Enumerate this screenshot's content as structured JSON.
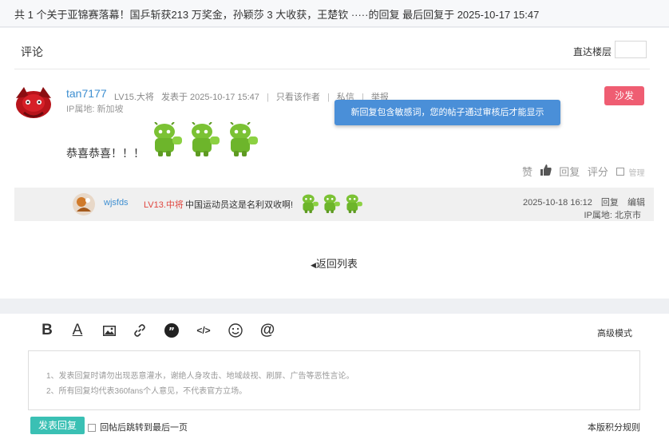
{
  "topbar": {
    "title": "共 1 个关于亚锦赛落幕！国乒斩获213 万奖金，孙颖莎 3 大收获，王楚钦 ·····的回复 最后回复于 2025-10-17 15:47"
  },
  "comments": {
    "title": "评论",
    "floor_jump_label": "直达楼层",
    "floor_input_value": ""
  },
  "post": {
    "username": "tan7177",
    "level": "LV15.大将",
    "posted": "发表于 2025-10-17 15:47",
    "only_author": "只看该作者",
    "message": "私信",
    "report": "举报",
    "ip": "IP属地: 新加坡",
    "sofa": "沙发",
    "tip": "新回复包含敏感词，您的帖子通过审核后才能显示",
    "text": "恭喜恭喜！！！",
    "actions": {
      "like": "赞",
      "reply": "回复",
      "rate": "评分",
      "manage": "管理"
    }
  },
  "reply": {
    "username": "wjsfds",
    "level": "LV13.中将",
    "text": "中国运动员这是名利双收啊!",
    "time": "2025-10-18 16:12",
    "reply_label": "回复",
    "edit_label": "编辑",
    "ip": "IP属地: 北京市"
  },
  "back_list": "返回列表",
  "editor": {
    "adv_mode": "高级模式",
    "hint1": "1、发表回复时请勿出现恶意灌水，谢绝人身攻击、地域歧视、刷屏、广告等恶性言论。",
    "hint2": "2、所有回复均代表360fans个人意见，不代表官方立场。",
    "submit": "发表回复",
    "jump_last": "回帖后跳转到最后一页",
    "rules": "本版积分规则",
    "toolbar_icons": [
      "bold-icon",
      "font-color-icon",
      "image-icon",
      "link-icon",
      "quote-icon",
      "code-icon",
      "emoji-icon",
      "mention-icon"
    ]
  },
  "colors": {
    "link_blue": "#3e8fd1",
    "sofa_red": "#ef5d72",
    "tip_blue": "#4a8fd8",
    "submit_teal": "#3ac0b4",
    "level_red": "#e0463f"
  }
}
